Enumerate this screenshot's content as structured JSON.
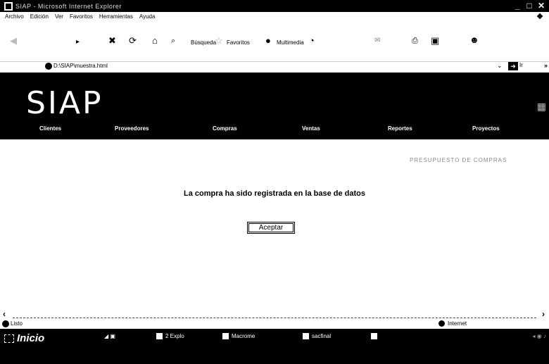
{
  "window": {
    "title": "SIAP - Microsoft Internet Explorer",
    "controls": {
      "minimize": "_",
      "maximize": "□",
      "close": "✕"
    }
  },
  "menubar": {
    "items": [
      "Archivo",
      "Edición",
      "Ver",
      "Favoritos",
      "Herramientas",
      "Ayuda"
    ]
  },
  "toolbar": {
    "search_label": "Búsqueda",
    "favorites_label": "Favoritos",
    "multimedia_label": "Multimedia"
  },
  "address": {
    "url": "D:\\SIAP\\muestra.html",
    "go_label": "Ir"
  },
  "page": {
    "logo": "SIAP",
    "nav": [
      "Clientes",
      "Proveedores",
      "Compras",
      "Ventas",
      "Reportes",
      "Proyectos"
    ],
    "breadcrumb": "PRESUPUESTO DE COMPRAS",
    "message": "La compra ha sido registrada en la base de datos",
    "accept_label": "Aceptar"
  },
  "statusbar": {
    "status": "Listo",
    "zone": "Internet"
  },
  "taskbar": {
    "start_label": "Inicio",
    "tasks": [
      "2 Explo",
      "Macrome",
      "sacfinal"
    ]
  }
}
